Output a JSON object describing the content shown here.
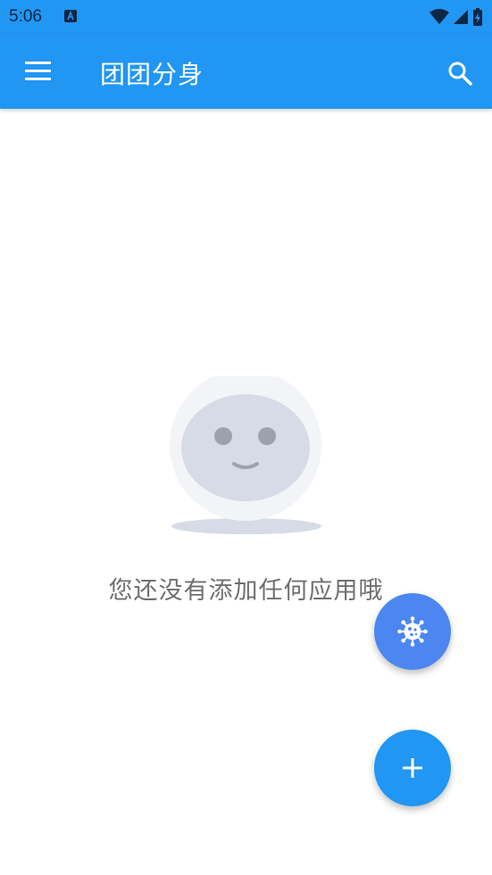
{
  "status_bar": {
    "time": "5:06",
    "icons": [
      "a-app-icon",
      "wifi-icon",
      "signal-icon",
      "battery-icon"
    ]
  },
  "app_bar": {
    "title": "团团分身",
    "left_icon": "menu-icon",
    "right_icon": "search-icon"
  },
  "empty_state": {
    "message": "您还没有添加任何应用哦",
    "illustration": "smiling-face-mascot"
  },
  "fabs": {
    "virus_icon": "virus-icon",
    "add_icon": "plus-icon"
  },
  "colors": {
    "primary": "#2196f3",
    "fab_virus": "#4c86f1",
    "text_gray": "#6f6f6f"
  }
}
